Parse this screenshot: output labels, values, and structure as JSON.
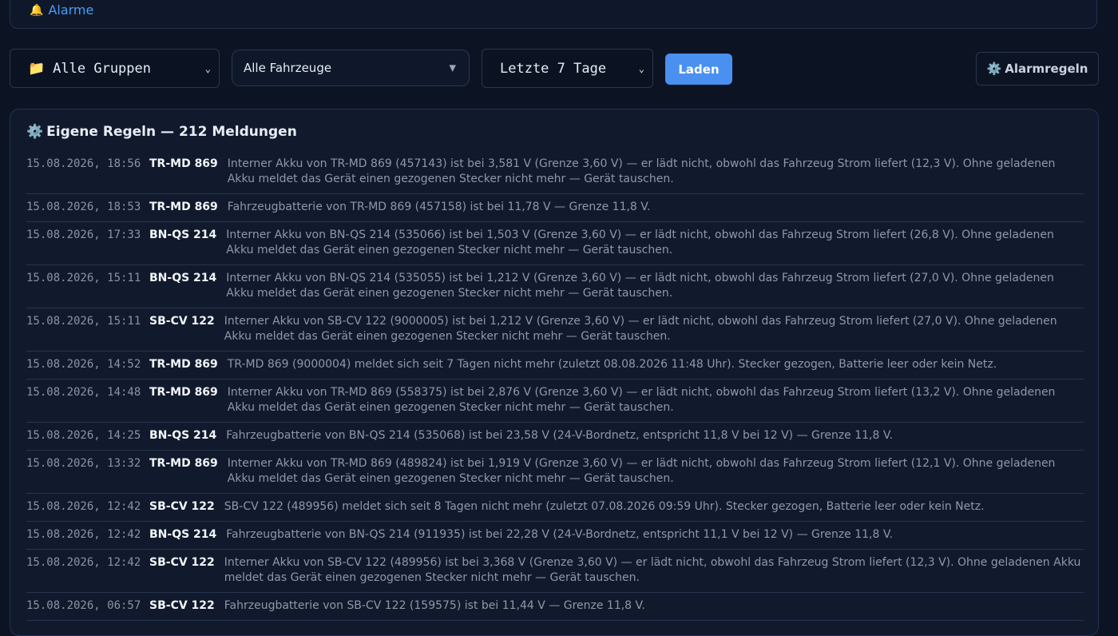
{
  "topbar": {
    "alarm_link": "Alarme",
    "bell_icon": "bell-icon"
  },
  "filters": {
    "group_select": "Alle Gruppen",
    "group_icon": "folder-icon",
    "vehicle_select": "Alle Fahrzeuge",
    "range_select": "Letzte 7 Tage",
    "load_button": "Laden",
    "alarm_rules_button": "Alarmregeln"
  },
  "panel": {
    "title": "Eigene Regeln — 212 Meldungen"
  },
  "rows": [
    {
      "ts": "15.08.2026, 18:56",
      "vehicle": "TR-MD 869",
      "message": "Interner Akku von TR-MD 869 (457143) ist bei 3,581 V (Grenze 3,60 V) — er lädt nicht, obwohl das Fahrzeug Strom liefert (12,3 V). Ohne geladenen Akku meldet das Gerät einen gezogenen Stecker nicht mehr — Gerät tauschen."
    },
    {
      "ts": "15.08.2026, 18:53",
      "vehicle": "TR-MD 869",
      "message": "Fahrzeugbatterie von TR-MD 869 (457158) ist bei 11,78 V — Grenze 11,8 V."
    },
    {
      "ts": "15.08.2026, 17:33",
      "vehicle": "BN-QS 214",
      "message": "Interner Akku von BN-QS 214 (535066) ist bei 1,503 V (Grenze 3,60 V) — er lädt nicht, obwohl das Fahrzeug Strom liefert (26,8 V). Ohne geladenen Akku meldet das Gerät einen gezogenen Stecker nicht mehr — Gerät tauschen."
    },
    {
      "ts": "15.08.2026, 15:11",
      "vehicle": "BN-QS 214",
      "message": "Interner Akku von BN-QS 214 (535055) ist bei 1,212 V (Grenze 3,60 V) — er lädt nicht, obwohl das Fahrzeug Strom liefert (27,0 V). Ohne geladenen Akku meldet das Gerät einen gezogenen Stecker nicht mehr — Gerät tauschen."
    },
    {
      "ts": "15.08.2026, 15:11",
      "vehicle": "SB-CV 122",
      "message": "Interner Akku von SB-CV 122 (9000005) ist bei 1,212 V (Grenze 3,60 V) — er lädt nicht, obwohl das Fahrzeug Strom liefert (27,0 V). Ohne geladenen Akku meldet das Gerät einen gezogenen Stecker nicht mehr — Gerät tauschen."
    },
    {
      "ts": "15.08.2026, 14:52",
      "vehicle": "TR-MD 869",
      "message": "TR-MD 869 (9000004) meldet sich seit 7 Tagen nicht mehr (zuletzt 08.08.2026 11:48 Uhr). Stecker gezogen, Batterie leer oder kein Netz."
    },
    {
      "ts": "15.08.2026, 14:48",
      "vehicle": "TR-MD 869",
      "message": "Interner Akku von TR-MD 869 (558375) ist bei 2,876 V (Grenze 3,60 V) — er lädt nicht, obwohl das Fahrzeug Strom liefert (13,2 V). Ohne geladenen Akku meldet das Gerät einen gezogenen Stecker nicht mehr — Gerät tauschen."
    },
    {
      "ts": "15.08.2026, 14:25",
      "vehicle": "BN-QS 214",
      "message": "Fahrzeugbatterie von BN-QS 214 (535068) ist bei 23,58 V (24-V-Bordnetz, entspricht 11,8 V bei 12 V) — Grenze 11,8 V."
    },
    {
      "ts": "15.08.2026, 13:32",
      "vehicle": "TR-MD 869",
      "message": "Interner Akku von TR-MD 869 (489824) ist bei 1,919 V (Grenze 3,60 V) — er lädt nicht, obwohl das Fahrzeug Strom liefert (12,1 V). Ohne geladenen Akku meldet das Gerät einen gezogenen Stecker nicht mehr — Gerät tauschen."
    },
    {
      "ts": "15.08.2026, 12:42",
      "vehicle": "SB-CV 122",
      "message": "SB-CV 122 (489956) meldet sich seit 8 Tagen nicht mehr (zuletzt 07.08.2026 09:59 Uhr). Stecker gezogen, Batterie leer oder kein Netz."
    },
    {
      "ts": "15.08.2026, 12:42",
      "vehicle": "BN-QS 214",
      "message": "Fahrzeugbatterie von BN-QS 214 (911935) ist bei 22,28 V (24-V-Bordnetz, entspricht 11,1 V bei 12 V) — Grenze 11,8 V."
    },
    {
      "ts": "15.08.2026, 12:42",
      "vehicle": "SB-CV 122",
      "message": "Interner Akku von SB-CV 122 (489956) ist bei 3,368 V (Grenze 3,60 V) — er lädt nicht, obwohl das Fahrzeug Strom liefert (12,3 V). Ohne geladenen Akku meldet das Gerät einen gezogenen Stecker nicht mehr — Gerät tauschen."
    },
    {
      "ts": "15.08.2026, 06:57",
      "vehicle": "SB-CV 122",
      "message": "Fahrzeugbatterie von SB-CV 122 (159575) ist bei 11,44 V — Grenze 11,8 V."
    }
  ]
}
